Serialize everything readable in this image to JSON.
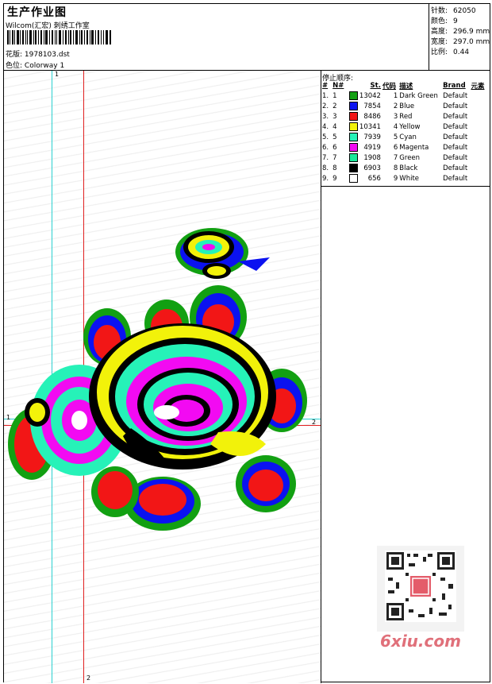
{
  "header": {
    "title": "生产作业图",
    "subtitle": "Wilcom(汇宏) 刺绣工作室",
    "design_label": "花版:",
    "design_value": "1978103.dst",
    "colorway_label": "色位:",
    "colorway_value": "Colorway 1"
  },
  "stats": [
    {
      "label": "针数:",
      "value": "62050"
    },
    {
      "label": "颜色:",
      "value": "9"
    },
    {
      "label": "高度:",
      "value": "296.9 mm"
    },
    {
      "label": "宽度:",
      "value": "297.0 mm"
    },
    {
      "label": "比例:",
      "value": "0.44"
    }
  ],
  "stop_sequence": {
    "label": "停止顺序:",
    "columns": [
      "#",
      "N#",
      "St.",
      "代码",
      "描述",
      "Brand",
      "元素"
    ],
    "rows": [
      {
        "num": "1.",
        "n": "1",
        "st": "13042",
        "code": "1",
        "desc": "Dark Green",
        "brand": "Default",
        "color": "#12a012"
      },
      {
        "num": "2.",
        "n": "2",
        "st": "7854",
        "code": "2",
        "desc": "Blue",
        "brand": "Default",
        "color": "#0b12f0"
      },
      {
        "num": "3.",
        "n": "3",
        "st": "8486",
        "code": "3",
        "desc": "Red",
        "brand": "Default",
        "color": "#f21616"
      },
      {
        "num": "4.",
        "n": "4",
        "st": "10341",
        "code": "4",
        "desc": "Yellow",
        "brand": "Default",
        "color": "#f2f20a"
      },
      {
        "num": "5.",
        "n": "5",
        "st": "7939",
        "code": "5",
        "desc": "Cyan",
        "brand": "Default",
        "color": "#26f2b8"
      },
      {
        "num": "6.",
        "n": "6",
        "st": "4919",
        "code": "6",
        "desc": "Magenta",
        "brand": "Default",
        "color": "#f20af2"
      },
      {
        "num": "7.",
        "n": "7",
        "st": "1908",
        "code": "7",
        "desc": "Green",
        "brand": "Default",
        "color": "#19e89a"
      },
      {
        "num": "8.",
        "n": "8",
        "st": "6903",
        "code": "8",
        "desc": "Black",
        "brand": "Default",
        "color": "#000000"
      },
      {
        "num": "9.",
        "n": "9",
        "st": "656",
        "code": "9",
        "desc": "White",
        "brand": "Default",
        "color": "#ffffff"
      }
    ]
  },
  "guides": {
    "v1": "1",
    "v2": "2",
    "h1": "1",
    "h2": "2"
  },
  "watermark": "6xiu.com"
}
